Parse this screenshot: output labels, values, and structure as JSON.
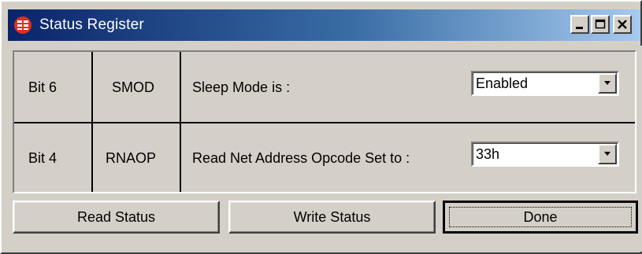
{
  "window": {
    "title": "Status Register",
    "icon": "app-logo-icon",
    "controls": [
      "minimize-icon",
      "maximize-icon",
      "close-icon"
    ]
  },
  "rows": [
    {
      "bit": "Bit 6",
      "name": "SMOD",
      "description": "Sleep Mode is :",
      "selected_value": "Enabled"
    },
    {
      "bit": "Bit 4",
      "name": "RNAOP",
      "description": "Read Net Address Opcode Set to :",
      "selected_value": "33h"
    }
  ],
  "buttons": {
    "read_status": "Read Status",
    "write_status": "Write Status",
    "done": "Done"
  },
  "colors": {
    "titlebar_start": "#0a246a",
    "titlebar_end": "#a6caf0",
    "face": "#d4d0c8",
    "icon_red": "#e03020"
  }
}
